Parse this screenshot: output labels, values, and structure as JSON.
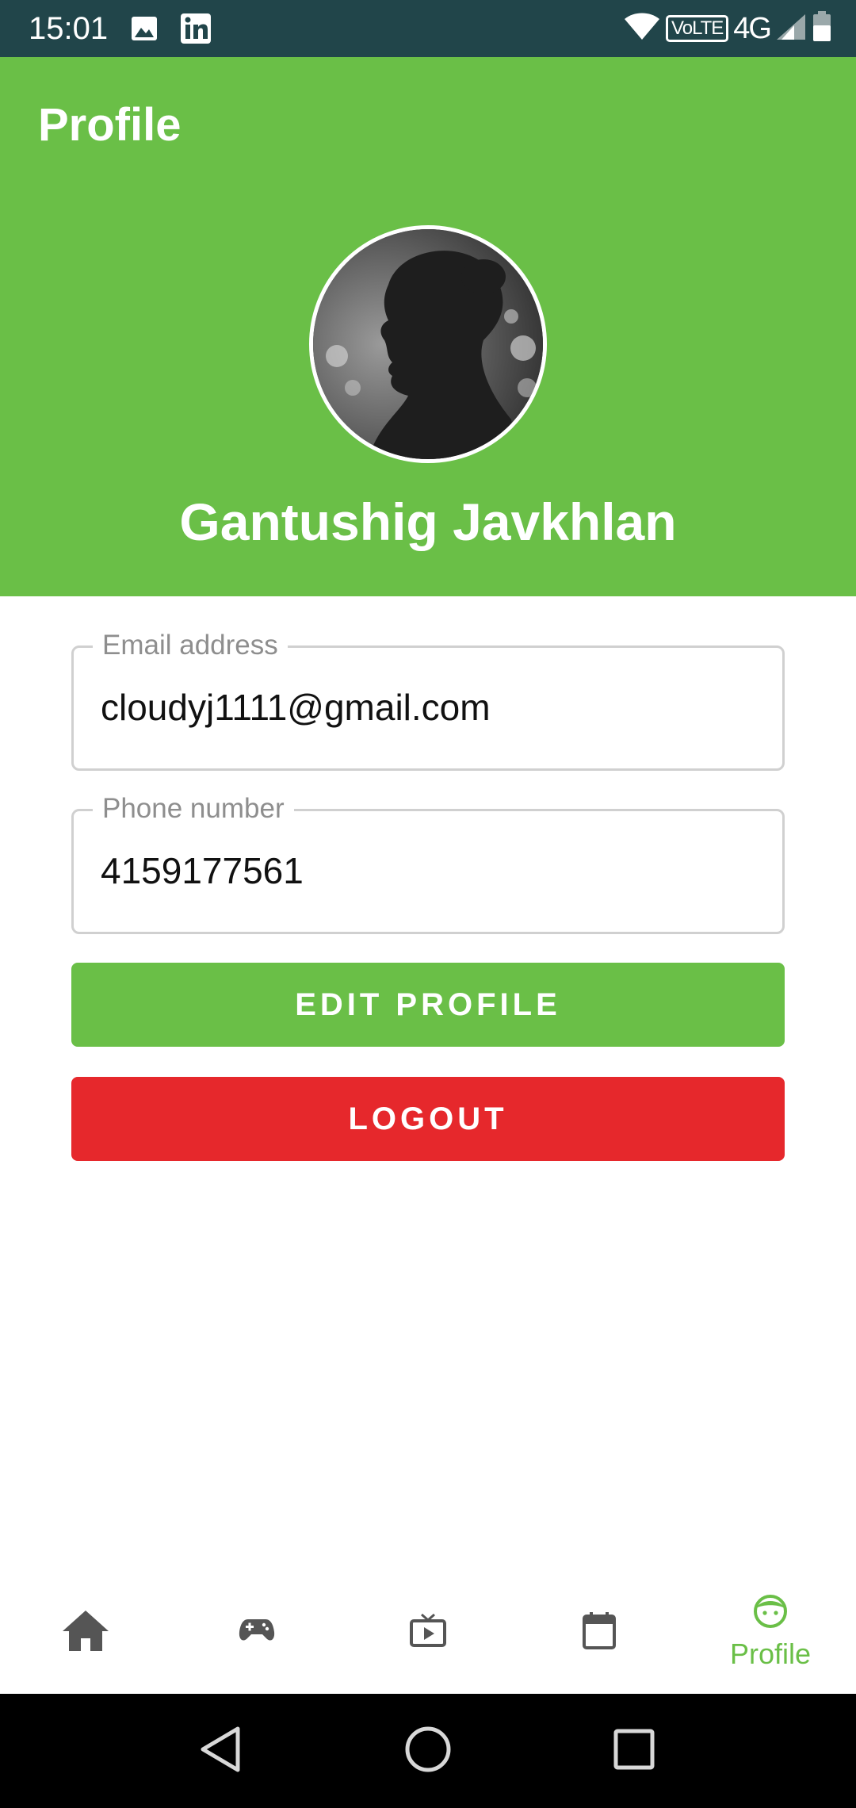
{
  "status_bar": {
    "time": "15:01",
    "network_badge": "VoLTE",
    "network_type": "4G",
    "icons": [
      "image-icon",
      "linkedin-icon",
      "wifi-icon",
      "signal-icon",
      "battery-icon"
    ]
  },
  "header": {
    "title": "Profile",
    "user_name": "Gantushig Javkhlan"
  },
  "form": {
    "email": {
      "label": "Email address",
      "value": "cloudyj1111@gmail.com"
    },
    "phone": {
      "label": "Phone number",
      "value": "4159177561"
    }
  },
  "buttons": {
    "edit_profile": "EDIT PROFILE",
    "logout": "LOGOUT"
  },
  "bottom_nav": {
    "items": [
      {
        "icon": "home-icon",
        "label": ""
      },
      {
        "icon": "gamepad-icon",
        "label": ""
      },
      {
        "icon": "tv-play-icon",
        "label": ""
      },
      {
        "icon": "calendar-icon",
        "label": ""
      },
      {
        "icon": "face-icon",
        "label": "Profile",
        "active": true
      }
    ]
  },
  "colors": {
    "status_bar": "#21454a",
    "brand_green": "#6abf47",
    "logout_red": "#e6282c",
    "nav_inactive": "#555555"
  }
}
